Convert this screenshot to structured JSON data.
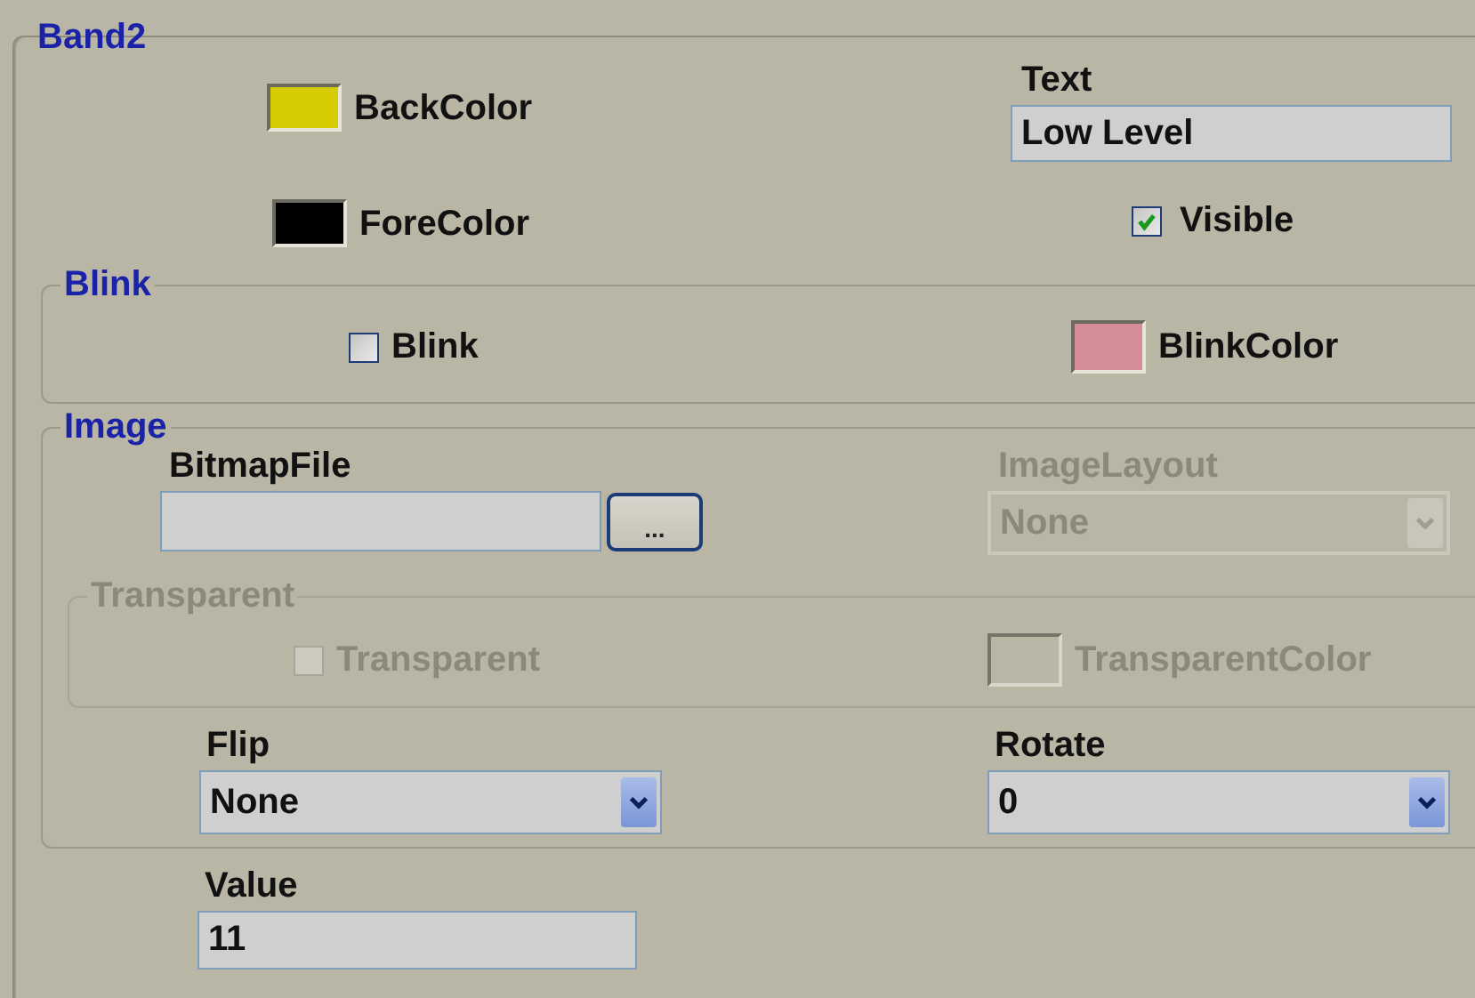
{
  "group": {
    "title": "Band2"
  },
  "back_color": {
    "label": "BackColor",
    "color": "#d4cc00"
  },
  "fore_color": {
    "label": "ForeColor",
    "color": "#000000"
  },
  "text_field": {
    "label": "Text",
    "value": "Low Level"
  },
  "visible": {
    "label": "Visible",
    "checked": true
  },
  "blink_group": {
    "title": "Blink",
    "blink": {
      "label": "Blink",
      "checked": false
    },
    "blink_color": {
      "label": "BlinkColor",
      "color": "#d48c98"
    }
  },
  "image_group": {
    "title": "Image",
    "bitmap_file": {
      "label": "BitmapFile",
      "browse": "..."
    },
    "image_layout": {
      "label": "ImageLayout",
      "value": "None",
      "disabled": true
    },
    "transparent_group": {
      "title": "Transparent",
      "disabled": true,
      "transparent": {
        "label": "Transparent",
        "checked": false
      },
      "transparent_color": {
        "label": "TransparentColor"
      }
    },
    "flip": {
      "label": "Flip",
      "value": "None"
    },
    "rotate": {
      "label": "Rotate",
      "value": "0"
    }
  },
  "value_field": {
    "label": "Value",
    "value": "11"
  }
}
